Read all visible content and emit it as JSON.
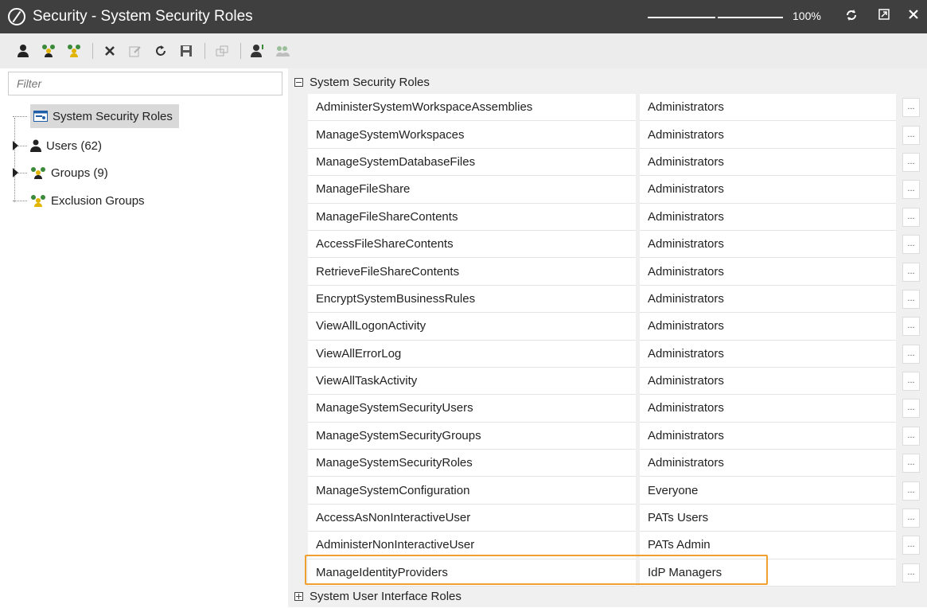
{
  "window": {
    "title": "Security - System Security Roles",
    "zoom": "100%",
    "zoom_fraction": 0.5
  },
  "toolbar": {
    "icons": [
      "user-icon",
      "group-icon",
      "exclusion-group-icon",
      "delete-icon",
      "edit-icon",
      "refresh-icon",
      "save-icon",
      "copy-icon",
      "user-roles-icon",
      "group-roles-icon"
    ]
  },
  "filter": {
    "placeholder": "Filter"
  },
  "tree": {
    "root": "System Security Roles",
    "users": "Users (62)",
    "groups": "Groups (9)",
    "exclusion": "Exclusion Groups"
  },
  "roles_section": {
    "header": "System Security Roles",
    "rows": [
      {
        "name": "AdministerSystemWorkspaceAssemblies",
        "group": "Administrators"
      },
      {
        "name": "ManageSystemWorkspaces",
        "group": "Administrators"
      },
      {
        "name": "ManageSystemDatabaseFiles",
        "group": "Administrators"
      },
      {
        "name": "ManageFileShare",
        "group": "Administrators"
      },
      {
        "name": "ManageFileShareContents",
        "group": "Administrators"
      },
      {
        "name": "AccessFileShareContents",
        "group": "Administrators"
      },
      {
        "name": "RetrieveFileShareContents",
        "group": "Administrators"
      },
      {
        "name": "EncryptSystemBusinessRules",
        "group": "Administrators"
      },
      {
        "name": "ViewAllLogonActivity",
        "group": "Administrators"
      },
      {
        "name": "ViewAllErrorLog",
        "group": "Administrators"
      },
      {
        "name": "ViewAllTaskActivity",
        "group": "Administrators"
      },
      {
        "name": "ManageSystemSecurityUsers",
        "group": "Administrators"
      },
      {
        "name": "ManageSystemSecurityGroups",
        "group": "Administrators"
      },
      {
        "name": "ManageSystemSecurityRoles",
        "group": "Administrators"
      },
      {
        "name": "ManageSystemConfiguration",
        "group": "Everyone"
      },
      {
        "name": "AccessAsNonInteractiveUser",
        "group": "PATs Users"
      },
      {
        "name": "AdministerNonInteractiveUser",
        "group": "PATs Admin"
      },
      {
        "name": "ManageIdentityProviders",
        "group": "IdP Managers"
      }
    ],
    "ellipsis": "..."
  },
  "ui_section": {
    "header": "System User Interface Roles"
  },
  "colors": {
    "titlebar": "#3f3f3f",
    "highlight": "#f0a030",
    "group_icon_green": "#3a8a3a",
    "group_icon_yellow": "#e0b400"
  }
}
